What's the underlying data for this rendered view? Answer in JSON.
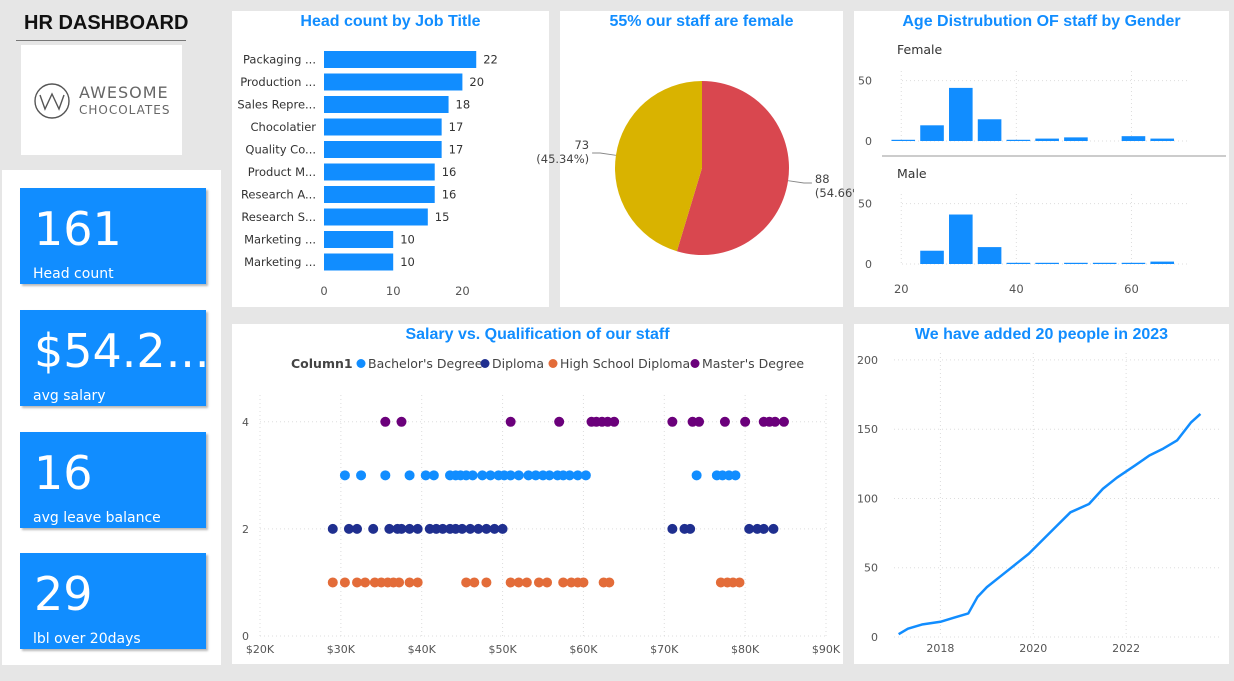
{
  "header": {
    "title": "HR DASHBOARD",
    "logo_line1": "AWESOME",
    "logo_line2": "CHOCOLATES"
  },
  "kpis": [
    {
      "value": "161",
      "label": "Head count"
    },
    {
      "value": "$54.2...",
      "label": "avg salary"
    },
    {
      "value": "16",
      "label": "avg leave balance"
    },
    {
      "value": "29",
      "label": "lbl over 20days"
    }
  ],
  "colors": {
    "accent": "#118dff",
    "bar": "#118dff",
    "female": "#d9474f",
    "male": "#d9b300",
    "bachelor": "#118dff",
    "diploma": "#1f2f8f",
    "highschool": "#e36c39",
    "masters": "#6b007b"
  },
  "chart_data": [
    {
      "type": "bar",
      "title": "Head count by Job Title",
      "categories": [
        "Packaging ...",
        "Production ...",
        "Sales Repre...",
        "Chocolatier",
        "Quality Co...",
        "Product M...",
        "Research A...",
        "Research S...",
        "Marketing ...",
        "Marketing ..."
      ],
      "values": [
        22,
        20,
        18,
        17,
        17,
        16,
        16,
        15,
        10,
        10
      ],
      "xticks": [
        "0",
        "10",
        "20"
      ],
      "xlim": [
        0,
        25
      ]
    },
    {
      "type": "pie",
      "title": "55% our staff are female",
      "slices": [
        {
          "value": 88,
          "label": "88",
          "pct": "(54.66%)"
        },
        {
          "value": 73,
          "label": "73",
          "pct": "(45.34%)"
        }
      ]
    },
    {
      "type": "bar",
      "title": "Age Distrubution OF staff by Gender",
      "x": [
        20,
        25,
        30,
        35,
        40,
        45,
        50,
        55,
        60,
        65
      ],
      "series": [
        {
          "name": "Female",
          "values": [
            1,
            13,
            44,
            18,
            1,
            2,
            3,
            0,
            4,
            2
          ]
        },
        {
          "name": "Male",
          "values": [
            0,
            11,
            41,
            14,
            1,
            1,
            1,
            1,
            1,
            2
          ]
        }
      ],
      "yticks": [
        "0",
        "50"
      ],
      "xticks": [
        "20",
        "40",
        "60"
      ],
      "xlim": [
        17,
        70
      ],
      "ylim": [
        0,
        58
      ]
    },
    {
      "type": "scatter",
      "title": "Salary vs. Qualification of our staff",
      "legend_title": "Column1",
      "xticks": [
        "$20K",
        "$30K",
        "$40K",
        "$50K",
        "$60K",
        "$70K",
        "$80K",
        "$90K"
      ],
      "yticks": [
        "0",
        "2",
        "4"
      ],
      "xlim": [
        20000,
        90000
      ],
      "ylim": [
        0,
        4.5
      ],
      "series": [
        {
          "name": "Bachelor's Degree",
          "y": 3,
          "x": [
            30500,
            32500,
            35500,
            38500,
            40500,
            41500,
            43500,
            44200,
            44800,
            45500,
            46300,
            47500,
            48500,
            49500,
            50200,
            51000,
            52000,
            53200,
            54100,
            55000,
            55800,
            56800,
            57500,
            58300,
            59300,
            60300,
            74000,
            76500,
            77200,
            78000,
            78800
          ]
        },
        {
          "name": "Diploma",
          "y": 2,
          "x": [
            29000,
            31000,
            32000,
            34000,
            36000,
            37000,
            37500,
            38500,
            39500,
            41000,
            41800,
            42600,
            43500,
            44200,
            45000,
            46000,
            47000,
            48000,
            49000,
            50000,
            71000,
            72500,
            73200,
            80500,
            81500,
            82300,
            83500
          ]
        },
        {
          "name": "High School Diploma",
          "y": 1,
          "x": [
            29000,
            30500,
            32000,
            33000,
            34200,
            35000,
            35800,
            36500,
            37200,
            38500,
            39500,
            45500,
            46500,
            48000,
            51000,
            52000,
            53000,
            54500,
            55500,
            57500,
            58500,
            59300,
            60000,
            62500,
            63200,
            77000,
            77800,
            78500,
            79300
          ]
        },
        {
          "name": "Master's Degree",
          "y": 4,
          "x": [
            35500,
            37500,
            51000,
            57000,
            61000,
            61600,
            62300,
            63000,
            63800,
            71000,
            73500,
            74300,
            77500,
            80000,
            82300,
            83000,
            83700,
            84800
          ]
        }
      ]
    },
    {
      "type": "line",
      "title": "We have added 20 people in 2023",
      "xticks": [
        "2018",
        "2020",
        "2022"
      ],
      "yticks": [
        "0",
        "50",
        "100",
        "150",
        "200"
      ],
      "xlim": [
        2017,
        2024
      ],
      "ylim": [
        0,
        205
      ],
      "x": [
        2017.1,
        2017.3,
        2017.6,
        2018,
        2018.3,
        2018.6,
        2018.8,
        2019,
        2019.3,
        2019.6,
        2019.9,
        2020.2,
        2020.5,
        2020.8,
        2021.2,
        2021.5,
        2021.8,
        2022.2,
        2022.5,
        2022.8,
        2023.1,
        2023.4,
        2023.6
      ],
      "values": [
        2,
        6,
        9,
        11,
        14,
        17,
        29,
        36,
        44,
        52,
        60,
        70,
        80,
        90,
        96,
        107,
        115,
        124,
        131,
        136,
        142,
        155,
        161
      ]
    }
  ]
}
